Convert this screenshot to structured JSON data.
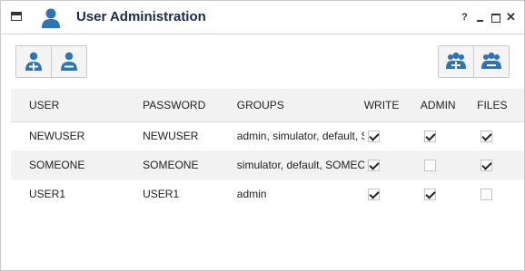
{
  "window": {
    "title": "User Administration",
    "controls": {
      "help": "?",
      "close": "✕"
    }
  },
  "icons": {
    "accent": "#2a74b8",
    "title_icon": "user-icon",
    "toolbar_left": [
      "add-user-icon",
      "remove-user-icon"
    ],
    "toolbar_right": [
      "add-group-icon",
      "remove-group-icon"
    ]
  },
  "table": {
    "columns": [
      "USER",
      "PASSWORD",
      "GROUPS",
      "WRITE",
      "ADMIN",
      "FILES"
    ],
    "rows": [
      {
        "user": "NEWUSER",
        "password": "NEWUSER",
        "groups": "admin, simulator, default, SOMEONE",
        "write": true,
        "admin": true,
        "files": true
      },
      {
        "user": "SOMEONE",
        "password": "SOMEONE",
        "groups": "simulator, default, SOMEONE",
        "write": true,
        "admin": false,
        "files": true
      },
      {
        "user": "USER1",
        "password": "USER1",
        "groups": "admin",
        "write": true,
        "admin": true,
        "files": false
      }
    ]
  }
}
